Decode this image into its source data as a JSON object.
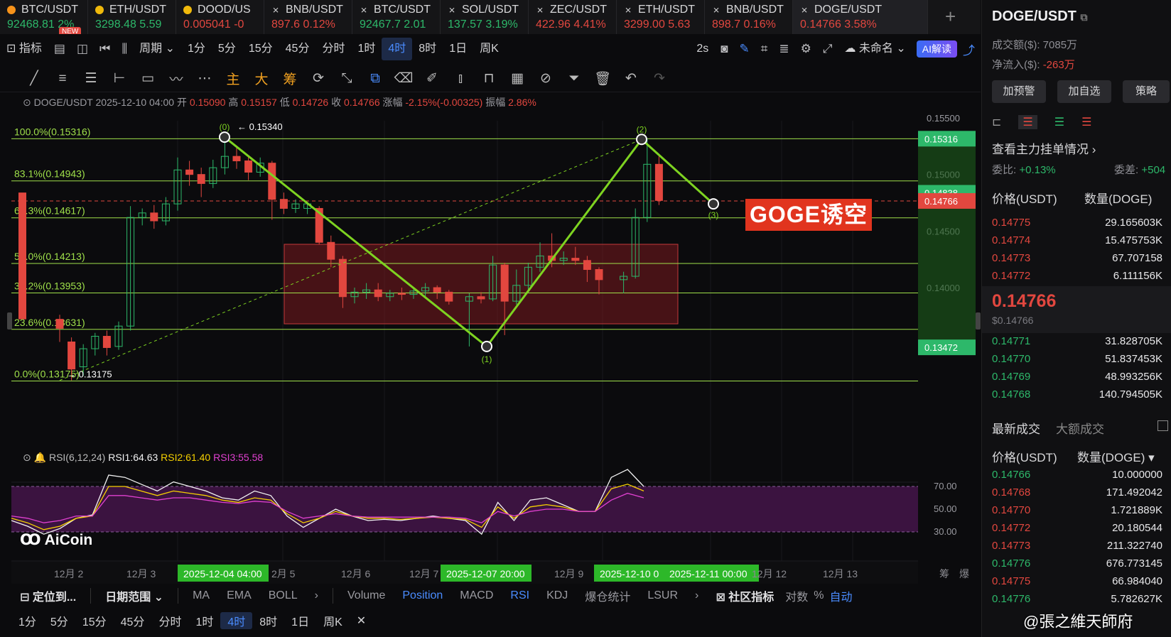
{
  "tabs": [
    {
      "symbol": "BTC/USDT",
      "price": "92468.81",
      "change": "2%",
      "dir": "up",
      "coin_color": "#f7931a",
      "badge": "NEW"
    },
    {
      "symbol": "ETH/USDT",
      "price": "3298.48",
      "change": "5.59",
      "dir": "up",
      "coin_color": "#f0b90b"
    },
    {
      "symbol": "DOOD/US",
      "price": "0.005041",
      "change": "-0",
      "dir": "down",
      "coin_color": "#f0b90b"
    },
    {
      "symbol": "BNB/USDT",
      "price": "897.6",
      "change": "0.12%",
      "dir": "down",
      "icon": "x-mark"
    },
    {
      "symbol": "BTC/USDT",
      "price": "92467.7",
      "change": "2.01",
      "dir": "up",
      "icon": "x-mark"
    },
    {
      "symbol": "SOL/USDT",
      "price": "137.57",
      "change": "3.19%",
      "dir": "up",
      "icon": "x-mark"
    },
    {
      "symbol": "ZEC/USDT",
      "price": "422.96",
      "change": "4.41%",
      "dir": "down",
      "icon": "x-mark"
    },
    {
      "symbol": "ETH/USDT",
      "price": "3299.00",
      "change": "5.63",
      "dir": "down",
      "icon": "x-mark"
    },
    {
      "symbol": "BNB/USDT",
      "price": "898.7",
      "change": "0.16%",
      "dir": "down",
      "icon": "x-mark"
    },
    {
      "symbol": "DOGE/USDT",
      "price": "0.14766",
      "change": "3.58%",
      "dir": "down",
      "icon": "x-mark",
      "active": true
    }
  ],
  "toolbar1": {
    "indicators": "指标",
    "period": "周期",
    "intervals": [
      "1分",
      "5分",
      "15分",
      "45分",
      "分时",
      "1时",
      "4时",
      "8时",
      "1日",
      "周K"
    ],
    "selected_interval": "4时",
    "refresh": "2s",
    "layout_name": "未命名",
    "ai_label": "AI解读"
  },
  "toolbar2": {
    "tools": [
      "trendline-icon",
      "parallel-icon",
      "hlines-icon",
      "hray-icon",
      "rect-icon",
      "wave-icon",
      "more-icon"
    ],
    "chars": [
      "主",
      "大",
      "筹"
    ]
  },
  "info": {
    "symbol": "DOGE/USDT",
    "time": "2025-12-10 04:00",
    "open_label": "开",
    "open": "0.15090",
    "high_label": "高",
    "high": "0.15157",
    "low_label": "低",
    "low": "0.14726",
    "close_label": "收",
    "close": "0.14766",
    "change_label": "涨幅",
    "change": "-2.15%(-0.00325)",
    "amp_label": "振幅",
    "amp": "2.86%"
  },
  "fib_labels": [
    "100.0%(0.15316)",
    "83.1%(0.14943)",
    "68.3%(0.14617)",
    "50.0%(0.14213)",
    "38.2%(0.13953)",
    "23.6%(0.13631)",
    "0.0%(0.13175)"
  ],
  "annotations": {
    "high_value": "0.15340",
    "low_value": "0.13175",
    "goge_label": "GOGE诱空",
    "wave_points": [
      "(0)",
      "(1)",
      "(2)",
      "(3)"
    ]
  },
  "price_axis": {
    "ticks": [
      "0.15500",
      "0.15000",
      "0.14500",
      "0.14000"
    ],
    "tag_top": "0.15316",
    "tag_mid": "0.14838",
    "tag_last": "0.14766",
    "tag_bottom": "0.13472"
  },
  "rsi": {
    "title": "RSI(6,12,24)",
    "rsi1": "RSI1:64.63",
    "rsi2": "RSI2:61.40",
    "rsi3": "RSI3:55.58",
    "ticks": [
      "70.00",
      "50.00",
      "30.00"
    ]
  },
  "time_axis": {
    "labels": [
      "12月 2",
      "12月 3",
      "2025-12-04 04:00",
      "2月 5",
      "12月 6",
      "12月 7",
      "2025-12-07 20:00",
      "12月 9",
      "2025-12-10 0",
      "2025-12-11 00:00",
      "12月 12",
      "12月 13"
    ],
    "right": [
      "筹",
      "爆"
    ]
  },
  "bottom_bar": {
    "locate": "定位到...",
    "date_range": "日期范围",
    "items": [
      "MA",
      "EMA",
      "BOLL",
      "Volume",
      "Position",
      "MACD",
      "RSI",
      "KDJ",
      "爆仓统计",
      "LSUR"
    ],
    "active": [
      "Position",
      "RSI"
    ],
    "community": "社区指标",
    "log": "对数",
    "pct": "%",
    "auto": "自动"
  },
  "period_bar": [
    "1分",
    "5分",
    "15分",
    "45分",
    "分时",
    "1时",
    "4时",
    "8时",
    "1日",
    "周K"
  ],
  "brand": {
    "logo_text": "AiCoin"
  },
  "right_panel": {
    "title": "DOGE/USDT",
    "volume_label": "成交额($): 7085万",
    "netflow_label": "净流入($):",
    "netflow_value": "-263万",
    "buttons": [
      "加预警",
      "加自选",
      "策略"
    ],
    "depth_link": "查看主力挂单情况",
    "ratio_label": "委比:",
    "ratio_value": "+0.13%",
    "diff_label": "委差:",
    "diff_value": "+504",
    "col_price": "价格(USDT)",
    "col_qty": "数量(DOGE)",
    "asks": [
      {
        "price": "0.14775",
        "qty": "29.165603K"
      },
      {
        "price": "0.14774",
        "qty": "15.475753K"
      },
      {
        "price": "0.14773",
        "qty": "67.707158"
      },
      {
        "price": "0.14772",
        "qty": "6.111156K"
      }
    ],
    "last_price": "0.14766",
    "last_usd": "$0.14766",
    "bids": [
      {
        "price": "0.14771",
        "qty": "31.828705K"
      },
      {
        "price": "0.14770",
        "qty": "51.837453K"
      },
      {
        "price": "0.14769",
        "qty": "48.993256K"
      },
      {
        "price": "0.14768",
        "qty": "140.794505K"
      }
    ],
    "trades_tab": "最新成交",
    "big_trades_tab": "大额成交",
    "trades_col_price": "价格(USDT)",
    "trades_col_qty": "数量(DOGE)",
    "trades": [
      {
        "price": "0.14766",
        "qty": "10.000000",
        "dir": "up"
      },
      {
        "price": "0.14768",
        "qty": "171.492042",
        "dir": "down"
      },
      {
        "price": "0.14770",
        "qty": "1.721889K",
        "dir": "down"
      },
      {
        "price": "0.14772",
        "qty": "20.180544",
        "dir": "down"
      },
      {
        "price": "0.14773",
        "qty": "211.322740",
        "dir": "down"
      },
      {
        "price": "0.14776",
        "qty": "676.773145",
        "dir": "up"
      },
      {
        "price": "0.14775",
        "qty": "66.984040",
        "dir": "down"
      },
      {
        "price": "0.14776",
        "qty": "5.782627K",
        "dir": "up"
      }
    ]
  },
  "watermark": "@張之維天師府",
  "colors": {
    "up": "#2db86a",
    "down": "#e2473f",
    "fib": "#9fe04a",
    "wave": "#7ed321",
    "box": "#7a1a1f",
    "rsi_band": "#3b1340"
  }
}
